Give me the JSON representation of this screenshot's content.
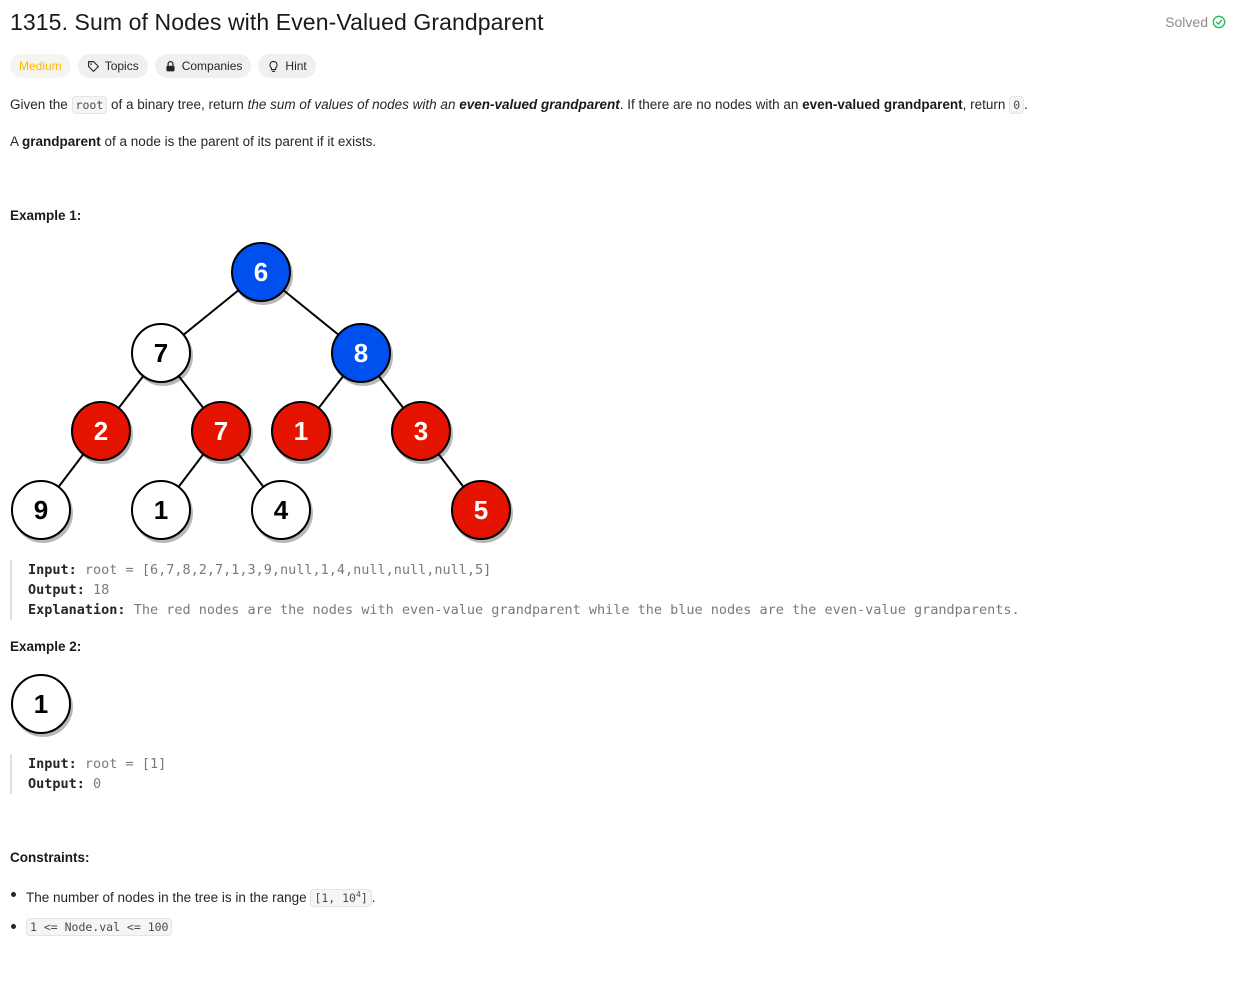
{
  "problem": {
    "title": "1315. Sum of Nodes with Even-Valued Grandparent",
    "status": "Solved",
    "tags": {
      "difficulty": "Medium",
      "topics": "Topics",
      "companies": "Companies",
      "hint": "Hint"
    },
    "description": {
      "p1_a": "Given the ",
      "p1_code": "root",
      "p1_b": " of a binary tree, return ",
      "p1_i": "the sum of values of nodes with an ",
      "p1_bi": "even-valued grandparent",
      "p1_c": ". If there are no nodes with an ",
      "p1_bold": "even-valued grandparent",
      "p1_d": ", return ",
      "p1_code2": "0",
      "p1_e": ".",
      "p2_a": "A ",
      "p2_bold": "grandparent",
      "p2_b": " of a node is the parent of its parent if it exists."
    },
    "examples": [
      {
        "heading": "Example 1:",
        "input_label": "Input:",
        "input": "root = [6,7,8,2,7,1,3,9,null,1,4,null,null,null,5]",
        "output_label": "Output:",
        "output": "18",
        "explanation_label": "Explanation:",
        "explanation": "The red nodes are the nodes with even-value grandparent while the blue nodes are the even-value grandparents.",
        "tree_nodes": [
          {
            "label": "6",
            "kind": "blue"
          },
          {
            "label": "7",
            "kind": "white"
          },
          {
            "label": "8",
            "kind": "blue"
          },
          {
            "label": "2",
            "kind": "red"
          },
          {
            "label": "7",
            "kind": "red"
          },
          {
            "label": "1",
            "kind": "red"
          },
          {
            "label": "3",
            "kind": "red"
          },
          {
            "label": "9",
            "kind": "white"
          },
          {
            "label": "1",
            "kind": "white"
          },
          {
            "label": "4",
            "kind": "white"
          },
          {
            "label": "5",
            "kind": "red"
          }
        ]
      },
      {
        "heading": "Example 2:",
        "input_label": "Input:",
        "input": "root = [1]",
        "output_label": "Output:",
        "output": "0",
        "tree_nodes": [
          {
            "label": "1",
            "kind": "white"
          }
        ]
      }
    ],
    "constraints": {
      "heading": "Constraints:",
      "c1_text": "The number of nodes in the tree is in the range ",
      "c1_code_a": "[1, 10",
      "c1_sup": "4",
      "c1_code_b": "]",
      "c1_end": ".",
      "c2_code": "1 <= Node.val <= 100"
    },
    "colors": {
      "blue_node": "#0050ef",
      "red_node": "#e51400",
      "white_node": "#ffffff",
      "difficulty": "#ffb800",
      "solved_check": "#2cbb5d"
    }
  }
}
